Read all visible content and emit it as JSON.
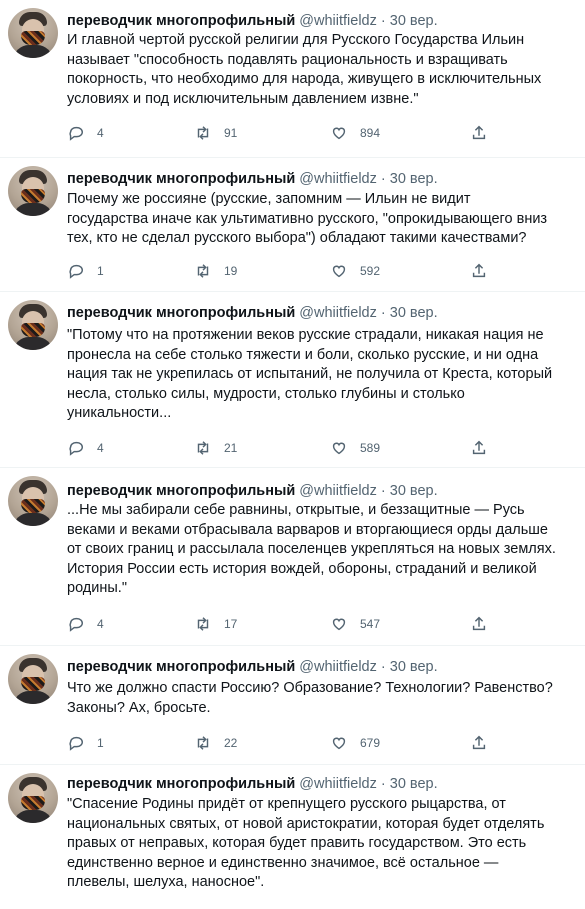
{
  "author": {
    "display_name": "переводчик многопрофильный",
    "handle": "@whiitfieldz",
    "date": "30 вер."
  },
  "separator": " · ",
  "tweets": [
    {
      "text": "И главной чертой русской религии для Русского Государства Ильин\nназывает \"способность подавлять рациональность и взращивать\nпокорность, что необходимо для народа, живущего в исключительных\nусловиях и под исключительным давлением извне.\"",
      "replies": "4",
      "retweets": "91",
      "likes": "894"
    },
    {
      "text": "Почему же россияне (русские, запомним — Ильин не видит\nгосударства иначе как ультимативно русского, \"опрокидывающего вниз\nтех, кто не сделал русского выбора\") обладают такими качествами?",
      "replies": "1",
      "retweets": "19",
      "likes": "592"
    },
    {
      "text": "\"Потому что на протяжении веков русские страдали, никакая нация не\nпронесла на себе столько тяжести и боли, сколько русские, и ни одна\nнация так не укрепилась от испытаний, не получила от Креста, который\nнесла, столько силы, мудрости, столько глубины и столько\nуникальности...",
      "replies": "4",
      "retweets": "21",
      "likes": "589"
    },
    {
      "text": "...Не мы забирали себе равнины, открытые, и беззащитные — Русь\nвеками и веками отбрасывала варваров и вторгающиеся орды дальше\nот своих границ и рассылала поселенцев укрепляться на новых землях.\nИстория России есть история вождей, обороны, страданий и великой\nродины.\"",
      "replies": "4",
      "retweets": "17",
      "likes": "547"
    },
    {
      "text": "Что же должно спасти Россию? Образование? Технологии? Равенство?\nЗаконы? Ах, бросьте.",
      "replies": "1",
      "retweets": "22",
      "likes": "679"
    },
    {
      "text": "\"Спасение Родины придёт от крепнущего русского рыцарства, от\nнациональных святых, от новой аристократии, которая будет отделять\nправых от неправых, которая будет править государством. Это есть\nединственно верное и единственно значимое, всё остальное —\nплевелы, шелуха, наносное\".",
      "replies": "",
      "retweets": "",
      "likes": ""
    }
  ],
  "icons": {
    "reply": "reply-icon",
    "retweet": "retweet-icon",
    "like": "heart-icon",
    "share": "share-icon"
  },
  "colors": {
    "text": "#0f1419",
    "muted": "#536471",
    "divider": "#eff3f4"
  }
}
